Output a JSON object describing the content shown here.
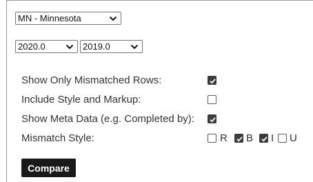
{
  "state_select": {
    "value": "MN - Minnesota"
  },
  "year_select_a": {
    "value": "2020.0"
  },
  "year_select_b": {
    "value": "2019.0"
  },
  "options": {
    "show_mismatched": {
      "label": "Show Only Mismatched Rows:",
      "checked": true
    },
    "include_style": {
      "label": "Include Style and Markup:",
      "checked": false
    },
    "show_meta": {
      "label": "Show Meta Data (e.g. Completed by):",
      "checked": true
    }
  },
  "mismatch_style": {
    "label": "Mismatch Style:",
    "items": [
      {
        "letter": "R",
        "checked": false
      },
      {
        "letter": "B",
        "checked": true
      },
      {
        "letter": "I",
        "checked": true
      },
      {
        "letter": "U",
        "checked": false
      }
    ]
  },
  "compare_button": {
    "label": "Compare"
  },
  "colors": {
    "text": "#333333",
    "button_bg": "#1a1a1a",
    "checked_fill": "#3b3b3b"
  }
}
